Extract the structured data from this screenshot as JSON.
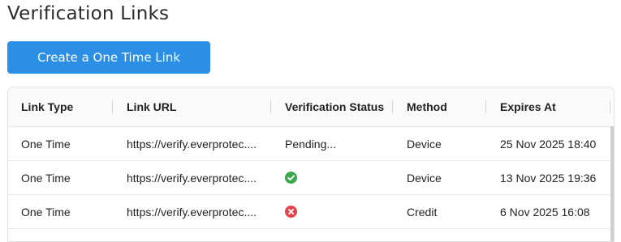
{
  "page": {
    "title": "Verification Links"
  },
  "actions": {
    "create_label": "Create a One Time Link"
  },
  "table": {
    "columns": [
      "Link Type",
      "Link URL",
      "Verification Status",
      "Method",
      "Expires At"
    ],
    "rows": [
      {
        "type": "One Time",
        "url": "https://verify.everprotec....",
        "status": "Pending...",
        "status_kind": "text",
        "method": "Device",
        "expires": "25 Nov 2025 18:40"
      },
      {
        "type": "One Time",
        "url": "https://verify.everprotec....",
        "status": "",
        "status_kind": "check-circle-icon",
        "method": "Device",
        "expires": "13 Nov 2025 19:36"
      },
      {
        "type": "One Time",
        "url": "https://verify.everprotec....",
        "status": "",
        "status_kind": "x-circle-icon",
        "method": "Credit",
        "expires": "6 Nov 2025 16:08"
      }
    ]
  },
  "colors": {
    "accent": "#2b8fe6",
    "success": "#3aa84a",
    "error": "#e8434b"
  }
}
